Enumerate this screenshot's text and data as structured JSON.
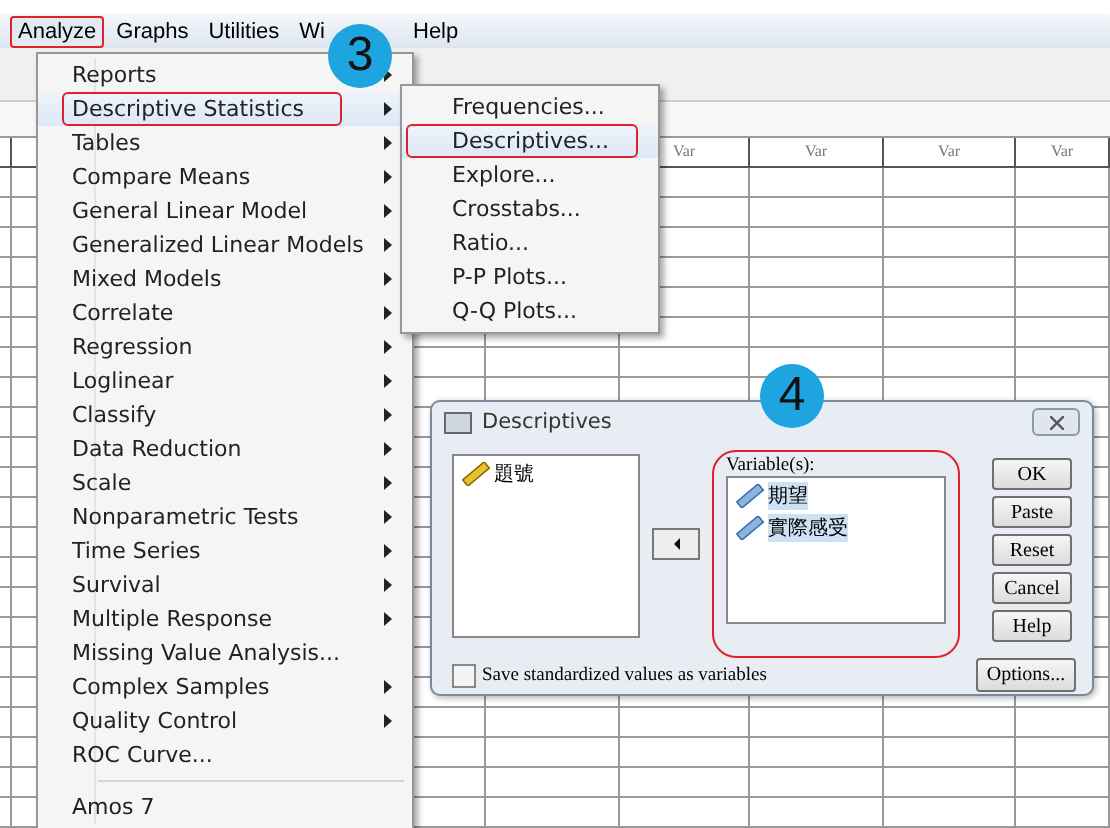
{
  "menu_bar": {
    "items": [
      {
        "label": "Analyze",
        "selected": true,
        "annotated": true
      },
      {
        "label": "Graphs",
        "selected": false,
        "annotated": false
      },
      {
        "label": "Utilities",
        "selected": false,
        "annotated": false
      },
      {
        "label": "Wi",
        "selected": false,
        "annotated": false
      },
      {
        "label": "Help",
        "selected": false,
        "annotated": false
      }
    ]
  },
  "data_grid": {
    "columns": [
      "Var",
      "Var",
      "Var",
      "Var"
    ]
  },
  "analyze_menu": {
    "items": [
      {
        "kind": "item",
        "label": "Reports",
        "submenu": true,
        "selected": false,
        "annotated": false
      },
      {
        "kind": "item",
        "label": "Descriptive Statistics",
        "submenu": true,
        "selected": true,
        "annotated": true
      },
      {
        "kind": "item",
        "label": "Tables",
        "submenu": true,
        "selected": false,
        "annotated": false
      },
      {
        "kind": "item",
        "label": "Compare Means",
        "submenu": true,
        "selected": false,
        "annotated": false
      },
      {
        "kind": "item",
        "label": "General Linear Model",
        "submenu": true,
        "selected": false,
        "annotated": false
      },
      {
        "kind": "item",
        "label": "Generalized Linear Models",
        "submenu": true,
        "selected": false,
        "annotated": false
      },
      {
        "kind": "item",
        "label": "Mixed Models",
        "submenu": true,
        "selected": false,
        "annotated": false
      },
      {
        "kind": "item",
        "label": "Correlate",
        "submenu": true,
        "selected": false,
        "annotated": false
      },
      {
        "kind": "item",
        "label": "Regression",
        "submenu": true,
        "selected": false,
        "annotated": false
      },
      {
        "kind": "item",
        "label": "Loglinear",
        "submenu": true,
        "selected": false,
        "annotated": false
      },
      {
        "kind": "item",
        "label": "Classify",
        "submenu": true,
        "selected": false,
        "annotated": false
      },
      {
        "kind": "item",
        "label": "Data Reduction",
        "submenu": true,
        "selected": false,
        "annotated": false
      },
      {
        "kind": "item",
        "label": "Scale",
        "submenu": true,
        "selected": false,
        "annotated": false
      },
      {
        "kind": "item",
        "label": "Nonparametric Tests",
        "submenu": true,
        "selected": false,
        "annotated": false
      },
      {
        "kind": "item",
        "label": "Time Series",
        "submenu": true,
        "selected": false,
        "annotated": false
      },
      {
        "kind": "item",
        "label": "Survival",
        "submenu": true,
        "selected": false,
        "annotated": false
      },
      {
        "kind": "item",
        "label": "Multiple Response",
        "submenu": true,
        "selected": false,
        "annotated": false
      },
      {
        "kind": "item",
        "label": "Missing Value Analysis...",
        "submenu": false,
        "selected": false,
        "annotated": false
      },
      {
        "kind": "item",
        "label": "Complex Samples",
        "submenu": true,
        "selected": false,
        "annotated": false
      },
      {
        "kind": "item",
        "label": "Quality Control",
        "submenu": true,
        "selected": false,
        "annotated": false
      },
      {
        "kind": "item",
        "label": "ROC Curve...",
        "submenu": false,
        "selected": false,
        "annotated": false
      },
      {
        "kind": "separator"
      },
      {
        "kind": "item",
        "label": "Amos 7",
        "submenu": false,
        "selected": false,
        "annotated": false
      }
    ]
  },
  "descriptive_submenu": {
    "items": [
      {
        "label": "Frequencies...",
        "selected": false,
        "annotated": false
      },
      {
        "label": "Descriptives...",
        "selected": true,
        "annotated": true
      },
      {
        "label": "Explore...",
        "selected": false,
        "annotated": false
      },
      {
        "label": "Crosstabs...",
        "selected": false,
        "annotated": false
      },
      {
        "label": "Ratio...",
        "selected": false,
        "annotated": false
      },
      {
        "label": "P-P Plots...",
        "selected": false,
        "annotated": false
      },
      {
        "label": "Q-Q Plots...",
        "selected": false,
        "annotated": false
      }
    ]
  },
  "dialog": {
    "title": "Descriptives",
    "source_list": [
      {
        "label": "題號",
        "selected": false
      }
    ],
    "variables": {
      "label": "Variable(s):",
      "annotated": true,
      "items": [
        {
          "label": "期望",
          "selected": true
        },
        {
          "label": "實際感受",
          "selected": true
        }
      ]
    },
    "checkbox": {
      "label": "Save standardized values as variables",
      "checked": false
    },
    "buttons": [
      "OK",
      "Paste",
      "Reset",
      "Cancel",
      "Help"
    ],
    "options_button": "Options..."
  },
  "step_markers": [
    {
      "label": "3"
    },
    {
      "label": "4"
    }
  ]
}
